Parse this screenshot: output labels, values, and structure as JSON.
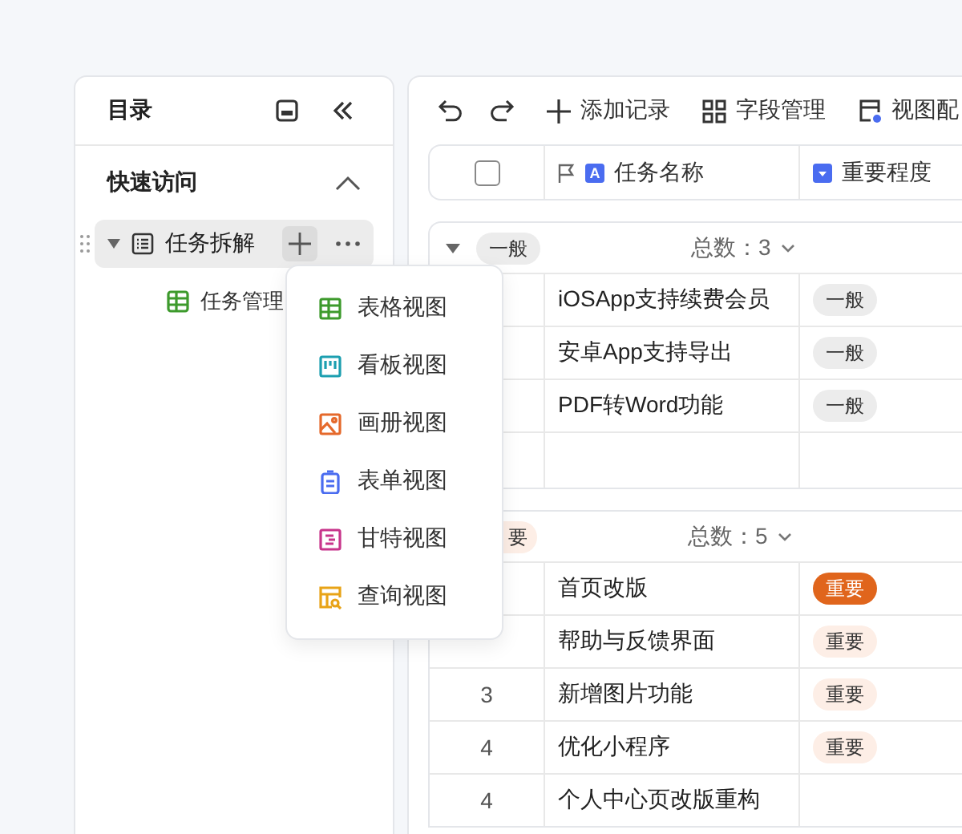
{
  "sidebar": {
    "title": "目录",
    "section": {
      "label": "快速访问",
      "expanded": true
    },
    "tree": [
      {
        "label": "任务拆解",
        "expanded": true,
        "children": [
          {
            "label": "任务管理"
          }
        ]
      }
    ]
  },
  "menu": [
    {
      "label": "表格视图",
      "kind": "table"
    },
    {
      "label": "看板视图",
      "kind": "kanban"
    },
    {
      "label": "画册视图",
      "kind": "gallery"
    },
    {
      "label": "表单视图",
      "kind": "form"
    },
    {
      "label": "甘特视图",
      "kind": "gantt"
    },
    {
      "label": "查询视图",
      "kind": "query"
    }
  ],
  "toolbar": [
    {
      "label": "添加记录",
      "kind": "add"
    },
    {
      "label": "字段管理",
      "kind": "fields"
    },
    {
      "label": "视图配",
      "kind": "view"
    }
  ],
  "select_all": {
    "checked": false
  },
  "columns": [
    {
      "label": "任务名称",
      "type_glyph": "A"
    },
    {
      "label": "重要程度"
    }
  ],
  "groups": [
    {
      "tag": {
        "text": "一般",
        "kind": "normal"
      },
      "expanded": true,
      "count_label": "总数：",
      "count": "3",
      "rows": [
        {
          "name": "iOSApp支持续费会员",
          "tag": {
            "text": "一般",
            "kind": "normal"
          }
        },
        {
          "name": "安卓App支持导出",
          "tag": {
            "text": "一般",
            "kind": "normal"
          }
        },
        {
          "name": "PDF转Word功能",
          "tag": {
            "text": "一般",
            "kind": "normal"
          }
        }
      ],
      "empty_row": true
    },
    {
      "tag": {
        "text": "要",
        "kind": "light"
      },
      "count_label": "总数：",
      "count": "5",
      "rows": [
        {
          "name": "首页改版",
          "tag": {
            "text": "重要",
            "kind": "strong"
          }
        },
        {
          "name": "帮助与反馈界面",
          "tag": {
            "text": "重要",
            "kind": "light"
          }
        },
        {
          "number": "3",
          "name": "新增图片功能",
          "tag": {
            "text": "重要",
            "kind": "light"
          }
        },
        {
          "number": "4",
          "name": "优化小程序",
          "tag": {
            "text": "重要",
            "kind": "light"
          }
        },
        {
          "number": "4",
          "name": "个人中心页改版重构"
        }
      ]
    }
  ]
}
